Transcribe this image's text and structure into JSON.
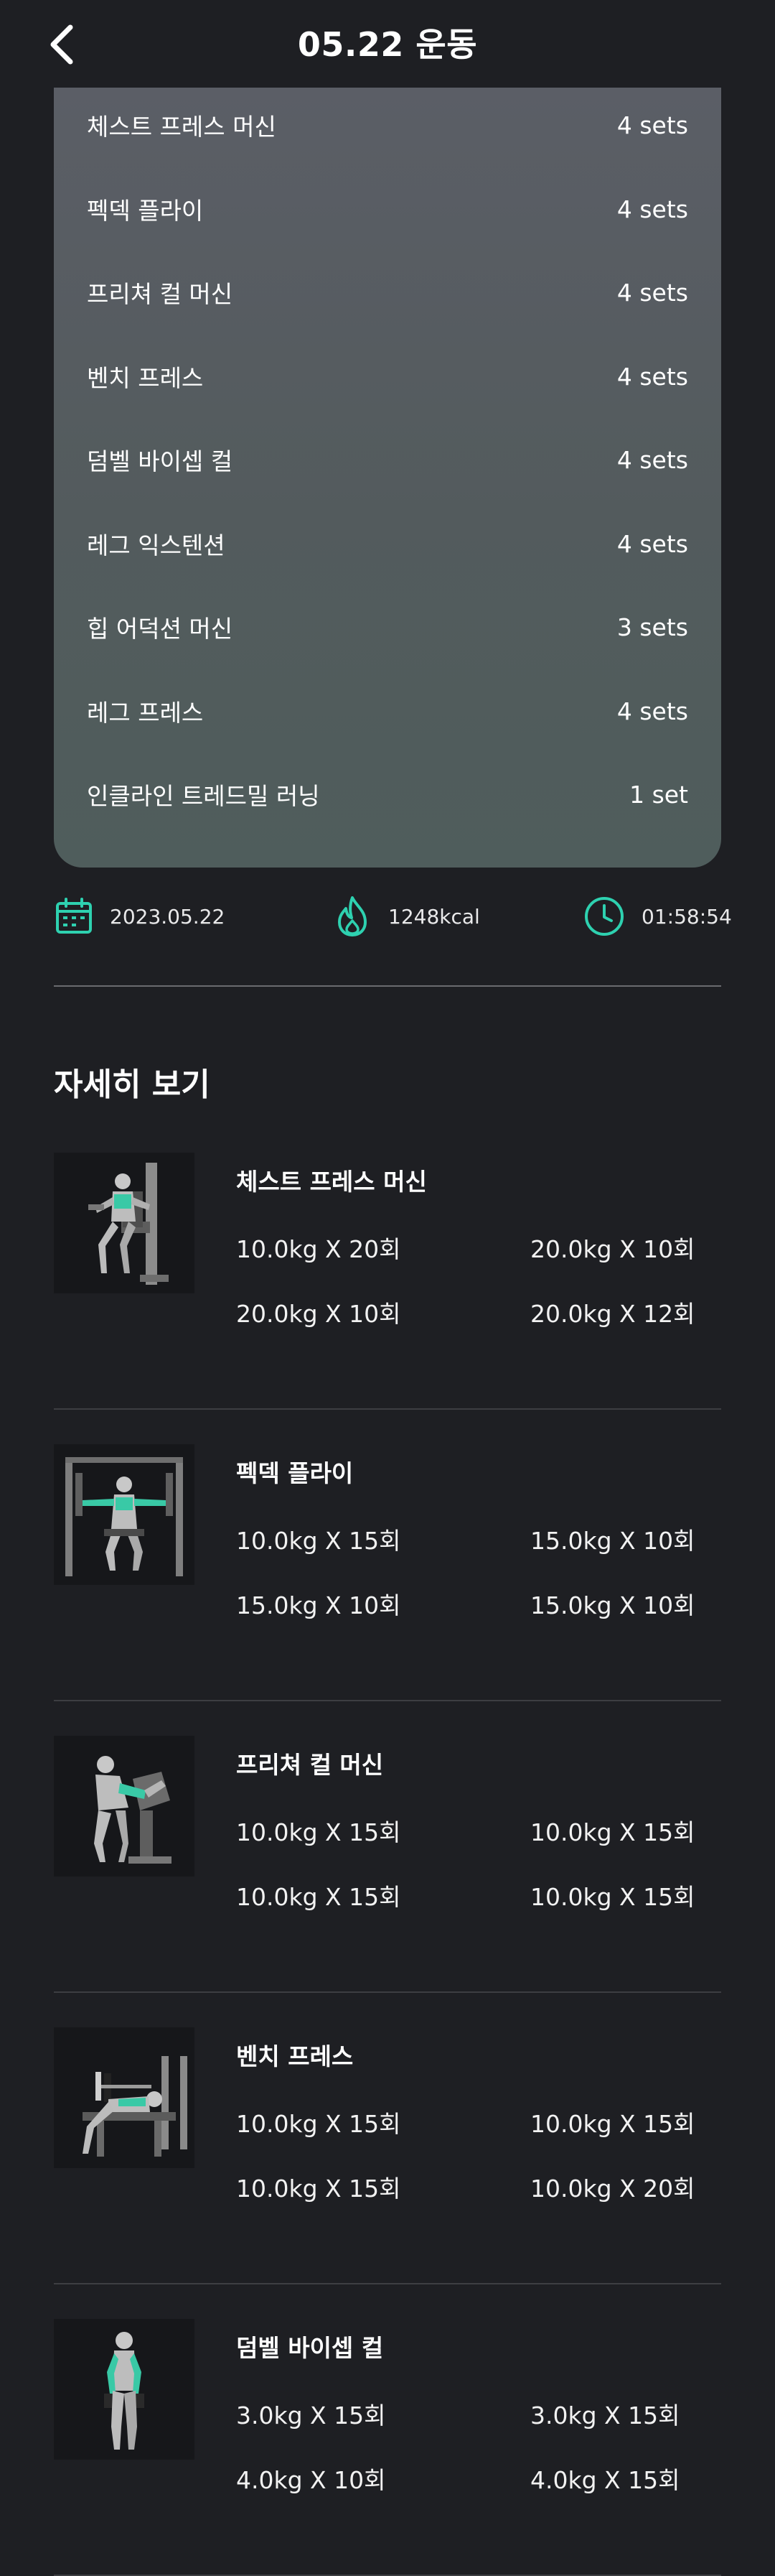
{
  "header": {
    "title": "05.22 운동"
  },
  "summary": {
    "rows": [
      {
        "name": "체스트 프레스 머신",
        "sets": "4 sets"
      },
      {
        "name": "펙덱 플라이",
        "sets": "4 sets"
      },
      {
        "name": "프리쳐 컬 머신",
        "sets": "4 sets"
      },
      {
        "name": "벤치 프레스",
        "sets": "4 sets"
      },
      {
        "name": "덤벨 바이셉 컬",
        "sets": "4 sets"
      },
      {
        "name": "레그 익스텐션",
        "sets": "4 sets"
      },
      {
        "name": "힙 어덕션 머신",
        "sets": "3 sets"
      },
      {
        "name": "레그 프레스",
        "sets": "4 sets"
      },
      {
        "name": "인클라인 트레드밀 러닝",
        "sets": "1 set"
      }
    ]
  },
  "stats": {
    "date": "2023.05.22",
    "calories": "1248kcal",
    "duration": "01:58:54"
  },
  "details": {
    "section_title": "자세히 보기",
    "items": [
      {
        "name": "체스트 프레스 머신",
        "sets": [
          "10.0kg X 20회",
          "20.0kg X 10회",
          "20.0kg X 10회",
          "20.0kg X 12회"
        ]
      },
      {
        "name": "펙덱 플라이",
        "sets": [
          "10.0kg X 15회",
          "15.0kg X 10회",
          "15.0kg X 10회",
          "15.0kg X 10회"
        ]
      },
      {
        "name": "프리쳐 컬 머신",
        "sets": [
          "10.0kg X 15회",
          "10.0kg X 15회",
          "10.0kg X 15회",
          "10.0kg X 15회"
        ]
      },
      {
        "name": "벤치 프레스",
        "sets": [
          "10.0kg X 15회",
          "10.0kg X 15회",
          "10.0kg X 15회",
          "10.0kg X 20회"
        ]
      },
      {
        "name": "덤벨 바이셉 컬",
        "sets": [
          "3.0kg X 15회",
          "3.0kg X 15회",
          "4.0kg X 10회",
          "4.0kg X 15회"
        ]
      }
    ]
  },
  "colors": {
    "background": "#1e1f23",
    "accent": "#2ed1b0",
    "card_top": "#5b5e66",
    "card_bottom": "#4f5d5c"
  },
  "icons": {
    "back": "chevron-left-icon",
    "date": "calendar-icon",
    "calories": "flame-icon",
    "duration": "clock-icon"
  }
}
